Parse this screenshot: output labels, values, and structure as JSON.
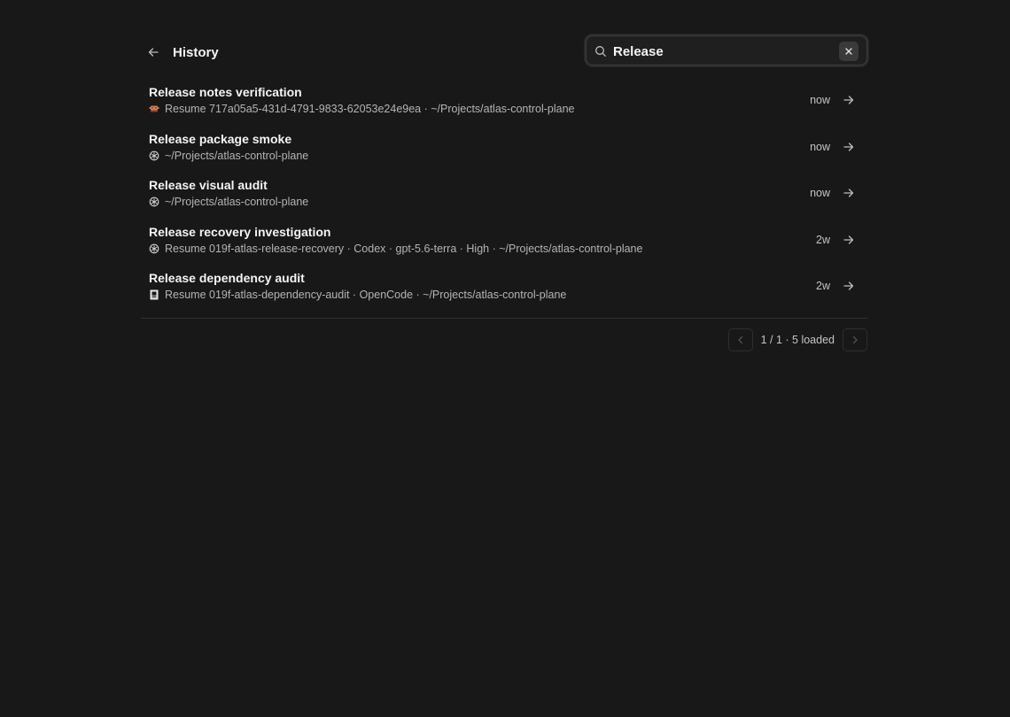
{
  "header": {
    "title": "History"
  },
  "search": {
    "value": "Release",
    "placeholder": ""
  },
  "sessions": [
    {
      "title": "Release notes verification",
      "subtitle": "Resume 717a05a5-431d-4791-9833-62053e24e9ea · ~/Projects/atlas-control-plane",
      "time": "now",
      "icon": "crab-icon"
    },
    {
      "title": "Release package smoke",
      "subtitle": "~/Projects/atlas-control-plane",
      "time": "now",
      "icon": "openai-icon"
    },
    {
      "title": "Release visual audit",
      "subtitle": "~/Projects/atlas-control-plane",
      "time": "now",
      "icon": "openai-icon"
    },
    {
      "title": "Release recovery investigation",
      "subtitle": "Resume 019f-atlas-release-recovery · Codex · gpt-5.6-terra · High · ~/Projects/atlas-control-plane",
      "time": "2w",
      "icon": "openai-icon"
    },
    {
      "title": "Release dependency audit",
      "subtitle": "Resume 019f-atlas-dependency-audit · OpenCode · ~/Projects/atlas-control-plane",
      "time": "2w",
      "icon": "opencode-icon"
    }
  ],
  "pagination": {
    "label": "1 / 1 · 5 loaded"
  },
  "colors": {
    "background": "#181818",
    "crab": "#d9774f"
  }
}
